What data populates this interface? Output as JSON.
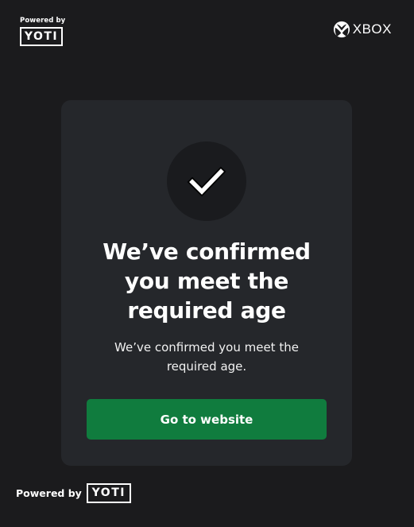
{
  "header": {
    "powered_by": "Powered by",
    "yoti_logo": "YOTI",
    "brand": {
      "icon": "xbox-sphere-icon",
      "text": "XBOX"
    }
  },
  "card": {
    "status_icon": "checkmark-icon",
    "title": "We’ve confirmed you meet the required age",
    "description": "We’ve confirmed you meet the required age.",
    "button_label": "Go to website"
  },
  "footer": {
    "powered_by": "Powered by",
    "yoti_logo": "YOTI"
  },
  "colors": {
    "background": "#1b1b1d",
    "card": "#25272b",
    "check_circle": "#1a1b1e",
    "button": "#107c3e",
    "text": "#ffffff"
  }
}
